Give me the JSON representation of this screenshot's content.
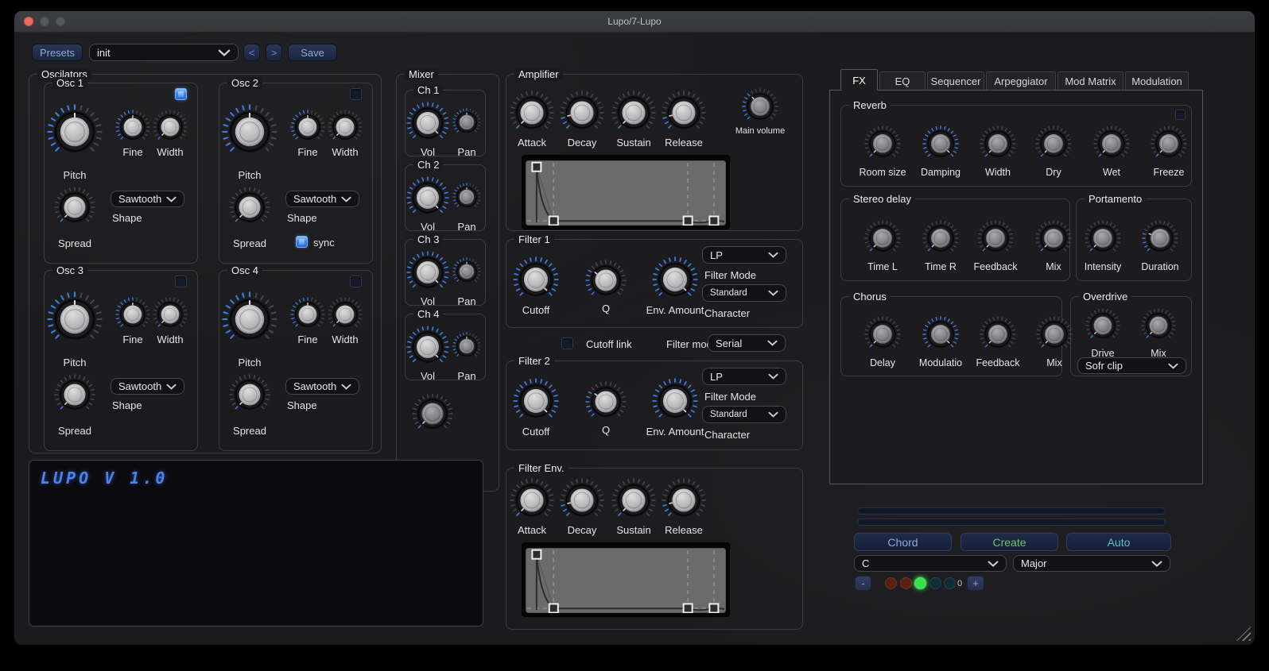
{
  "window": {
    "title": "Lupo/7-Lupo"
  },
  "toolbar": {
    "presets_label": "Presets",
    "preset_value": "init",
    "prev_label": "<",
    "next_label": ">",
    "save_label": "Save"
  },
  "theme": {
    "accent_blue": "#3d7de4",
    "button_text_blue": "#8fa9d9",
    "green": "#38e04c",
    "teal": "#59c0c9",
    "lcd_blue": "#4e82ea"
  },
  "oscillators": {
    "title": "Oscilators",
    "oscs": [
      {
        "name": "Osc 1",
        "enabled": true,
        "shape_label": "Shape",
        "shape_value": "Sawtooth",
        "knobs": {
          "pitch": {
            "label": "Pitch",
            "value": 0.5
          },
          "fine": {
            "label": "Fine",
            "value": 0.5
          },
          "width": {
            "label": "Width",
            "value": 0
          },
          "spread": {
            "label": "Spread",
            "value": 0
          }
        }
      },
      {
        "name": "Osc 2",
        "enabled": false,
        "shape_label": "Shape",
        "shape_value": "Sawtooth",
        "sync": {
          "label": "sync",
          "checked": true
        },
        "knobs": {
          "pitch": {
            "label": "Pitch",
            "value": 0.5
          },
          "fine": {
            "label": "Fine",
            "value": 0.5
          },
          "width": {
            "label": "Width",
            "value": 0
          },
          "spread": {
            "label": "Spread",
            "value": 0
          }
        }
      },
      {
        "name": "Osc 3",
        "enabled": false,
        "shape_label": "Shape",
        "shape_value": "Sawtooth",
        "knobs": {
          "pitch": {
            "label": "Pitch",
            "value": 0.5
          },
          "fine": {
            "label": "Fine",
            "value": 0.5
          },
          "width": {
            "label": "Width",
            "value": 0
          },
          "spread": {
            "label": "Spread",
            "value": 0
          }
        }
      },
      {
        "name": "Osc 4",
        "enabled": false,
        "shape_label": "Shape",
        "shape_value": "Sawtooth",
        "knobs": {
          "pitch": {
            "label": "Pitch",
            "value": 0.5
          },
          "fine": {
            "label": "Fine",
            "value": 0.5
          },
          "width": {
            "label": "Width",
            "value": 0
          },
          "spread": {
            "label": "Spread",
            "value": 0
          }
        }
      }
    ]
  },
  "mixer": {
    "title": "Mixer",
    "channels": [
      {
        "name": "Ch 1",
        "vol": {
          "label": "Vol",
          "value": 1
        },
        "pan": {
          "label": "Pan",
          "value": 0.5
        }
      },
      {
        "name": "Ch 2",
        "vol": {
          "label": "Vol",
          "value": 1
        },
        "pan": {
          "label": "Pan",
          "value": 0.5
        }
      },
      {
        "name": "Ch 3",
        "vol": {
          "label": "Vol",
          "value": 1
        },
        "pan": {
          "label": "Pan",
          "value": 0.5
        }
      },
      {
        "name": "Ch 4",
        "vol": {
          "label": "Vol",
          "value": 1
        },
        "pan": {
          "label": "Pan",
          "value": 0.5
        }
      }
    ],
    "master": {
      "label": "",
      "value": 0
    }
  },
  "amplifier": {
    "title": "Amplifier",
    "knobs": {
      "attack": {
        "label": "Attack",
        "value": 0
      },
      "decay": {
        "label": "Decay",
        "value": 0.12
      },
      "sustain": {
        "label": "Sustain",
        "value": 0
      },
      "release": {
        "label": "Release",
        "value": 0.12
      },
      "main_volume": {
        "label": "Main volume",
        "value": 0.35
      }
    },
    "envelope": {
      "handles": [
        [
          0.055,
          0.1
        ],
        [
          0.14,
          0.93
        ],
        [
          0.81,
          0.93
        ],
        [
          0.94,
          0.93
        ]
      ]
    }
  },
  "filter1": {
    "title": "Filter 1",
    "mode_value": "LP",
    "mode_label": "Filter Mode",
    "character_value": "Standard",
    "character_label": "Character",
    "knobs": {
      "cutoff": {
        "label": "Cutoff",
        "value": 1
      },
      "q": {
        "label": "Q",
        "value": 0.3
      },
      "env_amount": {
        "label": "Env. Amount",
        "value": 1
      }
    }
  },
  "link_row": {
    "checkbox_label": "Cutoff link",
    "checked": false,
    "mode_label": "Filter mode",
    "mode_value": "Serial"
  },
  "filter2": {
    "title": "Filter 2",
    "mode_value": "LP",
    "mode_label": "Filter Mode",
    "character_value": "Standard",
    "character_label": "Character",
    "knobs": {
      "cutoff": {
        "label": "Cutoff",
        "value": 1
      },
      "q": {
        "label": "Q",
        "value": 0.3
      },
      "env_amount": {
        "label": "Env. Amount",
        "value": 1
      }
    }
  },
  "filter_env": {
    "title": "Filter Env.",
    "knobs": {
      "attack": {
        "label": "Attack",
        "value": 0
      },
      "decay": {
        "label": "Decay",
        "value": 0.12
      },
      "sustain": {
        "label": "Sustain",
        "value": 0
      },
      "release": {
        "label": "Release",
        "value": 0.12
      }
    },
    "envelope": {
      "handles": [
        [
          0.055,
          0.1
        ],
        [
          0.14,
          0.93
        ],
        [
          0.81,
          0.93
        ],
        [
          0.94,
          0.93
        ]
      ]
    }
  },
  "fx": {
    "tabs": [
      "FX",
      "EQ",
      "Sequencer",
      "Arpeggiator",
      "Mod Matrix",
      "Modulation"
    ],
    "active_tab": "FX",
    "reverb": {
      "title": "Reverb",
      "enabled": false,
      "knobs": {
        "room_size": {
          "label": "Room size",
          "value": 0
        },
        "damping": {
          "label": "Damping",
          "value": 1
        },
        "width": {
          "label": "Width",
          "value": 0
        },
        "dry": {
          "label": "Dry",
          "value": 0
        },
        "wet": {
          "label": "Wet",
          "value": 0
        },
        "freeze": {
          "label": "Freeze",
          "value": 0
        }
      }
    },
    "stereo_delay": {
      "title": "Stereo delay",
      "knobs": {
        "time_l": {
          "label": "Time L",
          "value": 0
        },
        "time_r": {
          "label": "Time R",
          "value": 0
        },
        "feedback": {
          "label": "Feedback",
          "value": 0
        },
        "mix": {
          "label": "Mix",
          "value": 0
        }
      }
    },
    "portamento": {
      "title": "Portamento",
      "knobs": {
        "intensity": {
          "label": "Intensity",
          "value": 0
        },
        "duration": {
          "label": "Duration",
          "value": 0.25
        }
      }
    },
    "chorus": {
      "title": "Chorus",
      "knobs": {
        "delay": {
          "label": "Delay",
          "value": 0
        },
        "modulation": {
          "label": "Modulatio",
          "value": 1
        },
        "feedback": {
          "label": "Feedback",
          "value": 0
        },
        "mix": {
          "label": "Mix",
          "value": 0
        }
      }
    },
    "overdrive": {
      "title": "Overdrive",
      "clip_value": "Sofr clip",
      "knobs": {
        "drive": {
          "label": "Drive",
          "value": 0
        },
        "mix": {
          "label": "Mix",
          "value": 0
        }
      }
    }
  },
  "chord": {
    "buttons": {
      "chord": "Chord",
      "create": "Create",
      "auto": "Auto"
    },
    "root_value": "C",
    "scale_value": "Major",
    "minus_label": "-",
    "plus_label": "+",
    "count_label": "0",
    "dots": [
      {
        "color": "#58200f",
        "glow": false
      },
      {
        "color": "#58200f",
        "glow": false
      },
      {
        "color": "#38e04c",
        "glow": true
      },
      {
        "color": "#0f2c3d",
        "glow": false
      },
      {
        "color": "#0f2c3d",
        "glow": false
      }
    ]
  },
  "lcd": {
    "text": "LUPO V 1.0"
  }
}
